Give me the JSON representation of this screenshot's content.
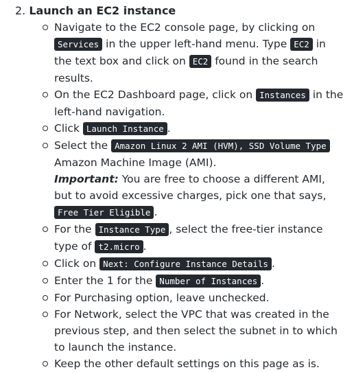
{
  "heading": {
    "number": "2.",
    "title": "Launch an EC2 instance"
  },
  "bullets": [
    {
      "t1": "Navigate to the EC2 console page, by clicking on ",
      "c1": "Services",
      "t2": " in the upper left-hand menu. Type ",
      "c2": "EC2",
      "t3": " in the text box and click on ",
      "c3": "EC2",
      "t4": " found in the search results."
    },
    {
      "t1": "On the EC2 Dashboard page, click on ",
      "c1": "Instances",
      "t2": " in the left-hand navigation."
    },
    {
      "t1": "Click ",
      "c1": "Launch Instance",
      "t2": "."
    },
    {
      "t1": "Select the ",
      "c1": "Amazon Linux 2 AMI (HVM), SSD Volume Type",
      "t2": " Amazon Machine Image (AMI).",
      "important_label": "Important:",
      "t3": " You are free to choose a different AMI, but to avoid excessive charges, pick one that says, ",
      "c2": "Free Tier Eligible",
      "t4": "."
    },
    {
      "t1": "For the ",
      "c1": "Instance Type",
      "t2": ", select the free-tier instance type of ",
      "c2": "t2.micro",
      "t3": "."
    },
    {
      "t1": "Click on ",
      "c1": "Next: Configure Instance Details",
      "t2": "."
    },
    {
      "t1": "Enter the 1 for the ",
      "c1": "Number of Instances",
      "t2": "."
    },
    {
      "t1": "For Purchasing option, leave unchecked."
    },
    {
      "t1": "For Network, select the VPC that was created in the previous step, and then select the subnet in to which to launch the instance."
    },
    {
      "t1": "Keep the other default settings on this page as is."
    }
  ]
}
